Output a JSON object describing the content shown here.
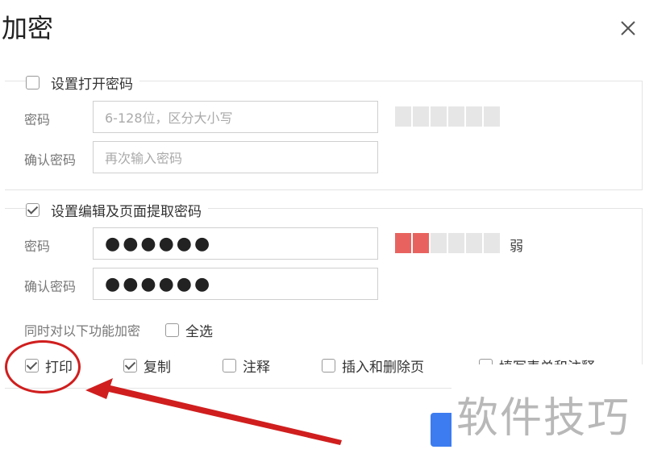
{
  "dialog": {
    "title": "加密"
  },
  "open_password": {
    "checkbox_label": "设置打开密码",
    "checked": false,
    "password_label": "密码",
    "password_placeholder": "6-128位，区分大小写",
    "confirm_label": "确认密码",
    "confirm_placeholder": "再次输入密码",
    "strength_level": 0
  },
  "edit_password": {
    "checkbox_label": "设置编辑及页面提取密码",
    "checked": true,
    "password_label": "密码",
    "password_value": "●●●●●●",
    "confirm_label": "确认密码",
    "confirm_value": "●●●●●●",
    "strength_level": 2,
    "strength_text": "弱",
    "encrypt_features_label": "同时对以下功能加密",
    "select_all_label": "全选",
    "options": [
      {
        "label": "打印",
        "checked": true
      },
      {
        "label": "复制",
        "checked": true
      },
      {
        "label": "注释",
        "checked": false
      },
      {
        "label": "插入和删除页",
        "checked": false
      },
      {
        "label": "填写表单和注释",
        "checked": false
      }
    ]
  },
  "watermark": "软件技巧",
  "annotation_color": "#d01e1e",
  "accent_color": "#3d7cf0"
}
